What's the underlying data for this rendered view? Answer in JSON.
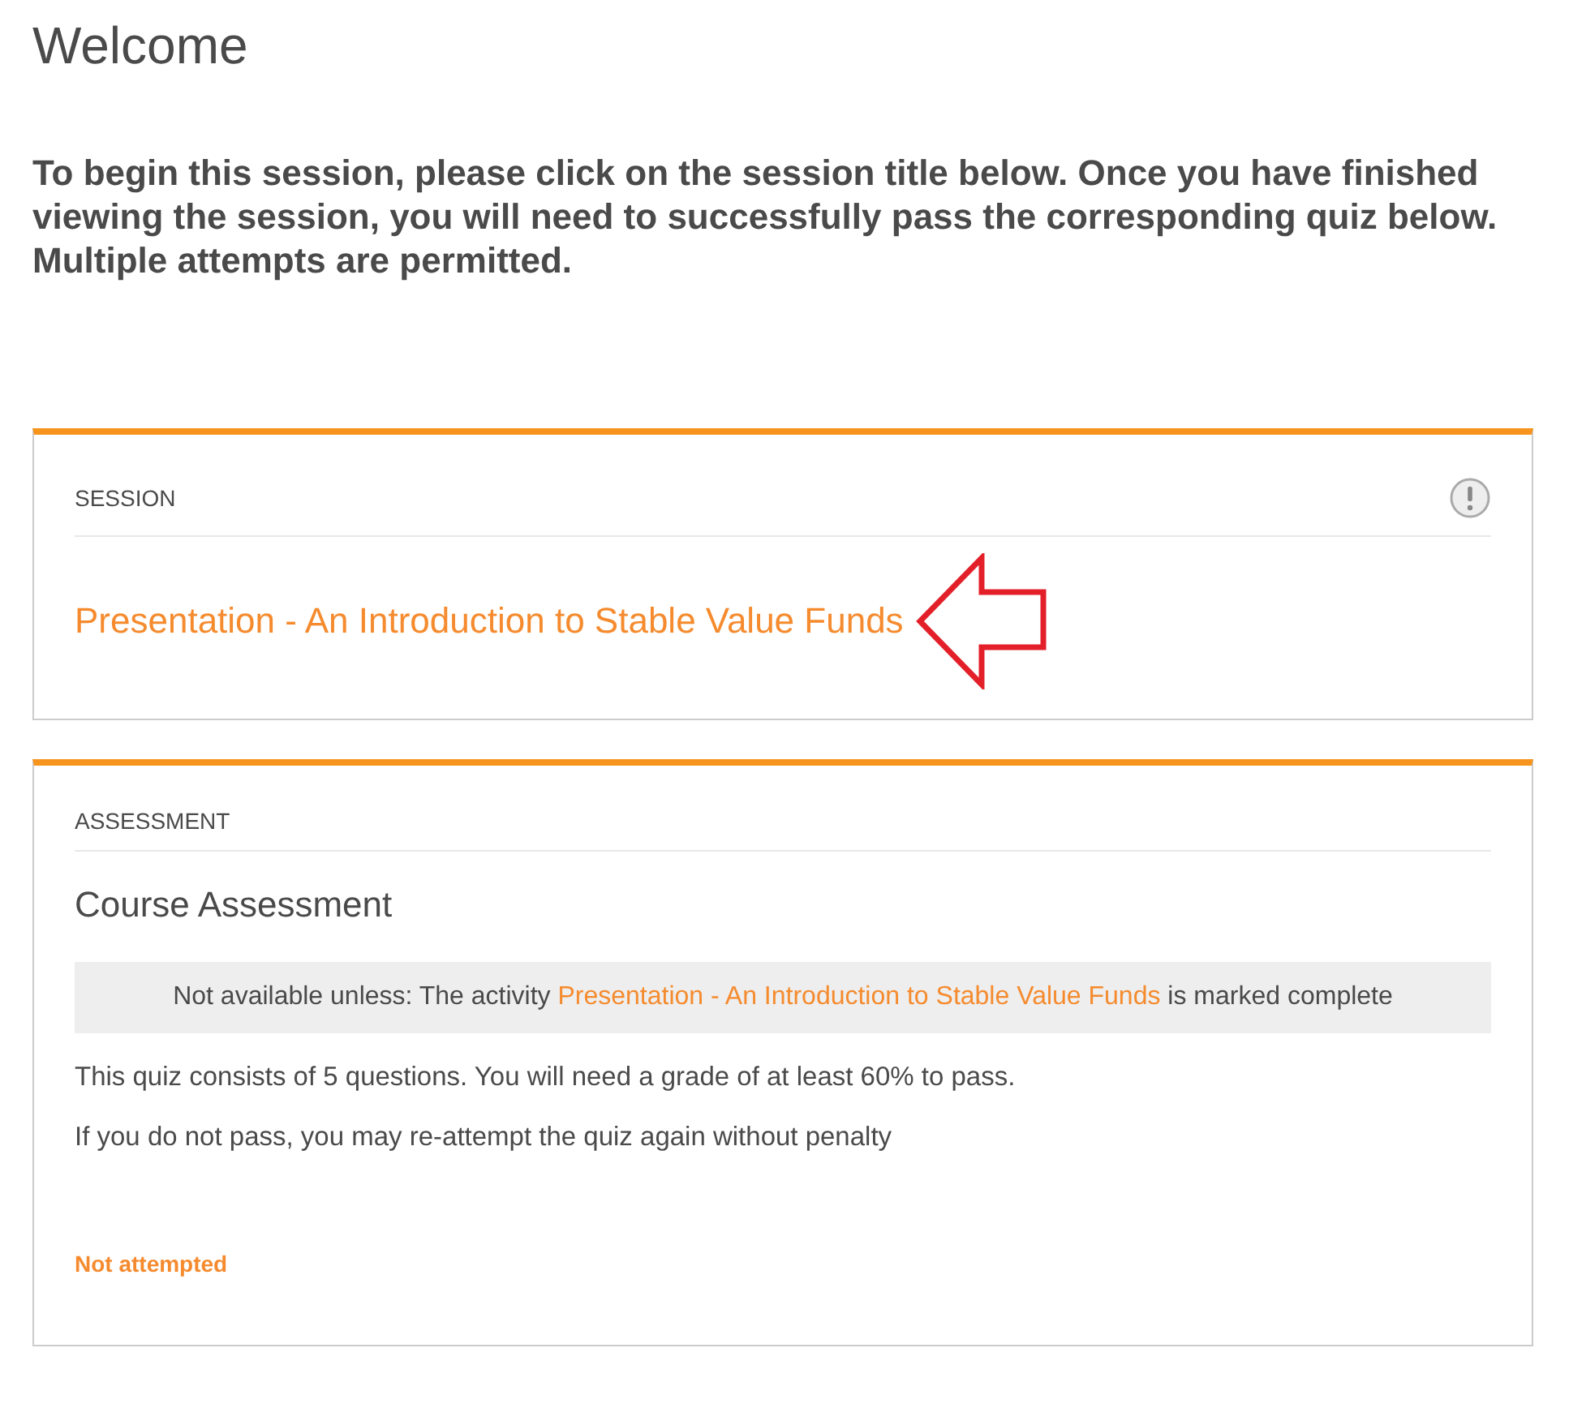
{
  "page_title": "Welcome",
  "intro": "To begin this session, please click on the session title below.  Once you have finished viewing the session, you will need to successfully pass the corresponding quiz below. Multiple attempts are permitted.",
  "session": {
    "section_label": "SESSION",
    "link": "Presentation - An Introduction to Stable Value Funds"
  },
  "assessment": {
    "section_label": "ASSESSMENT",
    "title": "Course Assessment",
    "restriction": {
      "text_before": "Not available unless: The activity ",
      "link": "Presentation - An Introduction to Stable Value Funds",
      "text_after": " is marked complete"
    },
    "paragraphs": [
      "This quiz consists of 5 questions. You will need a grade of at least 60% to pass.",
      "If you do not pass, you may re-attempt the quiz again without penalty"
    ],
    "status": "Not attempted"
  }
}
